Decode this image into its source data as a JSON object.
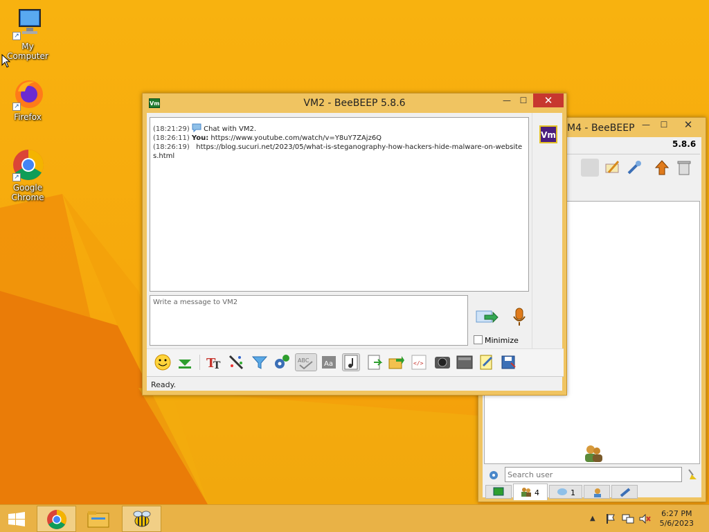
{
  "desktop": {
    "icons": [
      {
        "label": "My Computer"
      },
      {
        "label": "Firefox"
      },
      {
        "label": "Google Chrome"
      }
    ]
  },
  "vm4_window": {
    "title": "M4 - BeeBEEP",
    "version": "5.8.6",
    "search_placeholder": "Search user",
    "tabs": [
      {
        "count": "4"
      },
      {
        "count": "1"
      }
    ]
  },
  "vm2_window": {
    "title": "VM2 - BeeBEEP 5.8.6",
    "avatar_label": "Vm",
    "chat": [
      {
        "time": "(18:21:29)",
        "sender": "",
        "text": "Chat with VM2."
      },
      {
        "time": "(18:26:11)",
        "sender": "You:",
        "text": "https://www.youtube.com/watch/v=Y8uY7ZAjz6Q"
      },
      {
        "time": "(18:26:19)",
        "sender": "",
        "text": "https://blog.sucuri.net/2023/05/what-is-steganography-how-hackers-hide-malware-on-websites.html"
      }
    ],
    "message_placeholder": "Write a message to VM2",
    "minimize_label": "Minimize",
    "status": "Ready."
  },
  "taskbar": {
    "time": "6:27 PM",
    "date": "5/6/2023"
  },
  "colors": {
    "close_red": "#c7372f",
    "window_frame": "#f0c461",
    "avatar_bg": "#4b1e7d"
  }
}
